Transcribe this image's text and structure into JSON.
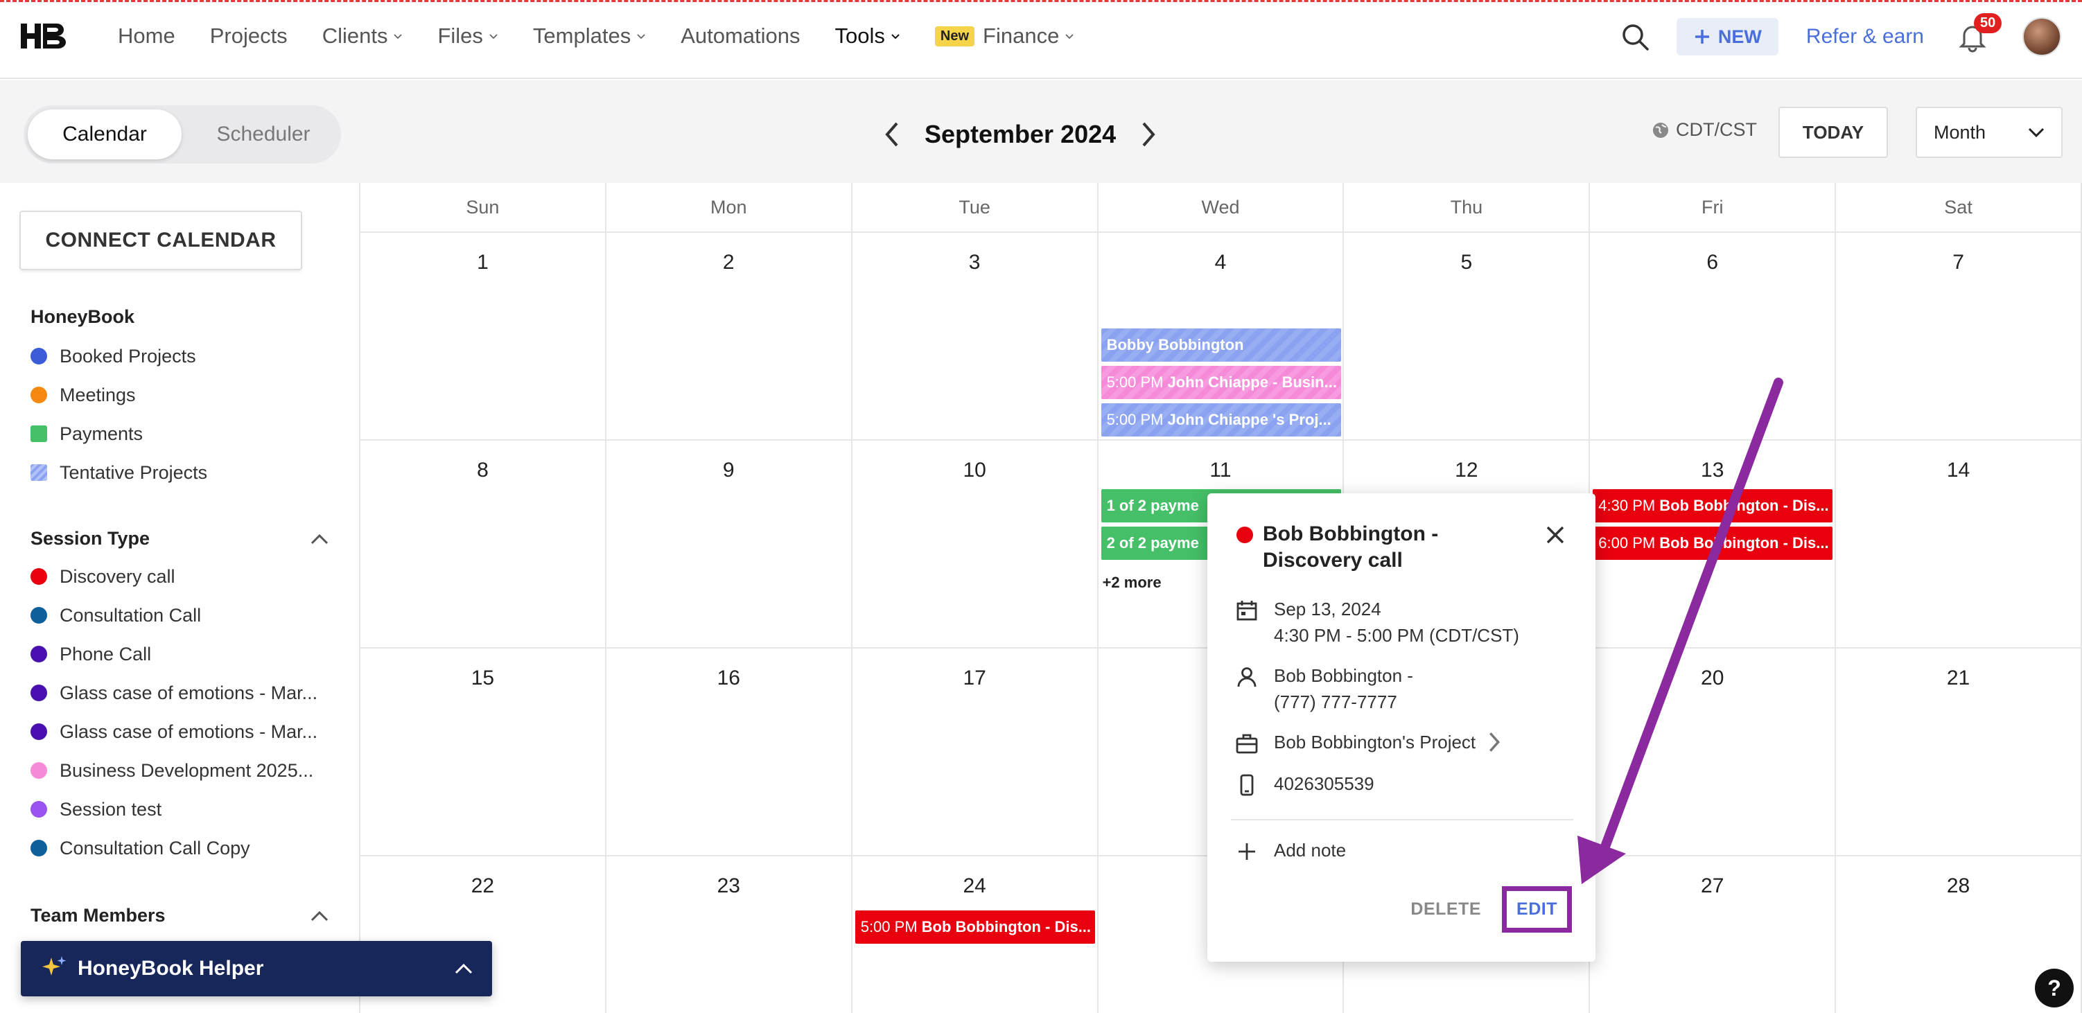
{
  "nav": {
    "items": [
      "Home",
      "Projects",
      "Clients",
      "Files",
      "Templates",
      "Automations",
      "Tools",
      "Finance"
    ],
    "new_tag": "New",
    "new_button": "NEW",
    "refer": "Refer & earn",
    "notifications": "50"
  },
  "subheader": {
    "tab_calendar": "Calendar",
    "tab_scheduler": "Scheduler",
    "month": "September 2024",
    "timezone": "CDT/CST",
    "today": "TODAY",
    "view": "Month"
  },
  "sidebar": {
    "connect": "CONNECT CALENDAR",
    "honeybook_title": "HoneyBook",
    "honeybook_items": [
      {
        "label": "Booked Projects",
        "color": "#3b5bd9"
      },
      {
        "label": "Meetings",
        "color": "#f5890f"
      },
      {
        "label": "Payments",
        "color": "#45bf68"
      },
      {
        "label": "Tentative Projects",
        "color": "#8aa2f0"
      }
    ],
    "session_title": "Session Type",
    "session_items": [
      {
        "label": "Discovery call",
        "color": "#e8000f"
      },
      {
        "label": "Consultation Call",
        "color": "#0e5f9a"
      },
      {
        "label": "Phone Call",
        "color": "#4a0fb0"
      },
      {
        "label": "Glass case of emotions - Mar...",
        "color": "#4a0fb0"
      },
      {
        "label": "Glass case of emotions - Mar...",
        "color": "#4a0fb0"
      },
      {
        "label": "Business Development 2025...",
        "color": "#f48ad8"
      },
      {
        "label": "Session test",
        "color": "#9a52f0"
      },
      {
        "label": "Consultation Call Copy",
        "color": "#0e5f9a"
      }
    ],
    "team_title": "Team Members",
    "helper": "HoneyBook Helper"
  },
  "calendar": {
    "days": [
      "Sun",
      "Mon",
      "Tue",
      "Wed",
      "Thu",
      "Fri",
      "Sat"
    ],
    "weeks": [
      [
        "1",
        "2",
        "3",
        "4",
        "5",
        "6",
        "7"
      ],
      [
        "8",
        "9",
        "10",
        "11",
        "12",
        "13",
        "14"
      ],
      [
        "15",
        "16",
        "17",
        "",
        "",
        "20",
        "21"
      ],
      [
        "22",
        "23",
        "24",
        "",
        "",
        "27",
        "28"
      ]
    ],
    "events": {
      "w1_bobby": "Bobby Bobbington",
      "w1_john1_time": "5:00 PM",
      "w1_john1": "John Chiappe - Busin...",
      "w1_john2_time": "5:00 PM",
      "w1_john2": "John Chiappe 's Proj...",
      "w2_pay1": "1 of 2 payme",
      "w2_pay2": "2 of 2 payme",
      "w2_more": "+2 more",
      "w2_fri1_time": "4:30 PM",
      "w2_fri1": "Bob Bobbington - Dis...",
      "w2_fri2_time": "6:00 PM",
      "w2_fri2": "Bob Bobbington - Dis...",
      "w4_tue_time": "5:00 PM",
      "w4_tue": "Bob Bobbington - Dis..."
    }
  },
  "popover": {
    "title": "Bob Bobbington - Discovery call",
    "date": "Sep 13, 2024",
    "time": "4:30 PM - 5:00 PM (CDT/CST)",
    "contact_name": "Bob Bobbington -",
    "contact_phone": "(777) 777-7777",
    "project": "Bob Bobbington's Project",
    "phone": "4026305539",
    "add_note": "Add note",
    "delete": "DELETE",
    "edit": "EDIT"
  },
  "help": "?"
}
